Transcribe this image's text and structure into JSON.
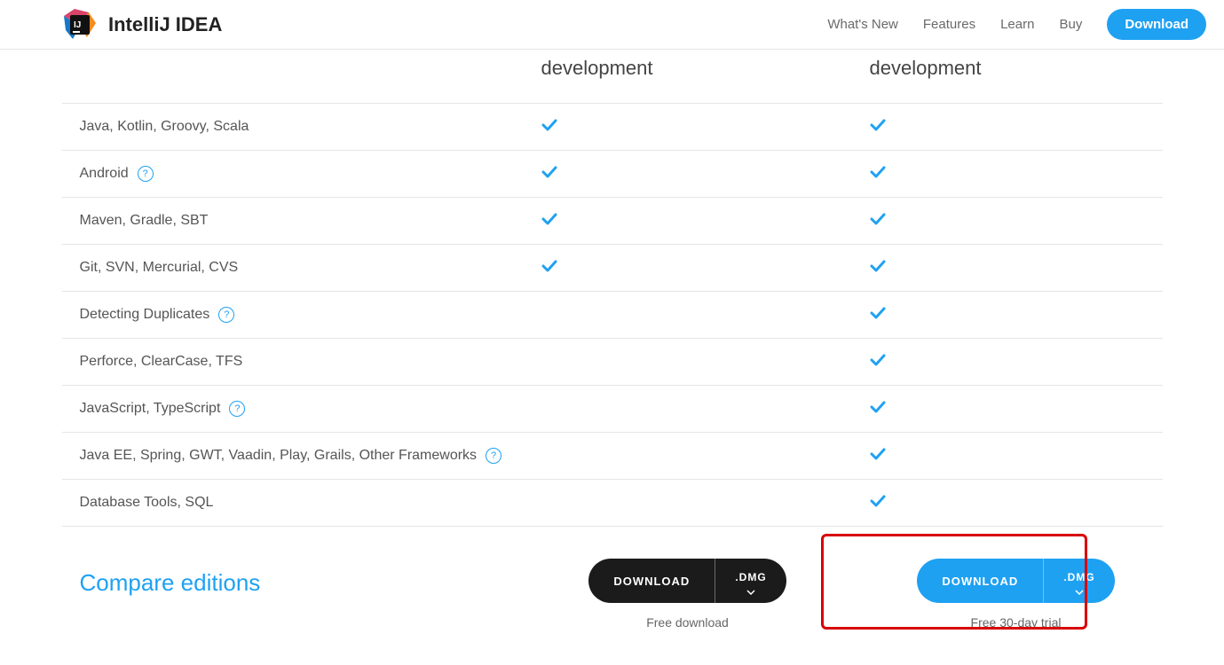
{
  "brand": {
    "title": "IntelliJ IDEA"
  },
  "nav": {
    "whats_new": "What's New",
    "features": "Features",
    "learn": "Learn",
    "buy": "Buy",
    "download": "Download"
  },
  "columns": {
    "community": "development",
    "ultimate": "development"
  },
  "features": [
    {
      "label": "Java, Kotlin, Groovy, Scala",
      "help": false,
      "community": true,
      "ultimate": true
    },
    {
      "label": "Android",
      "help": true,
      "community": true,
      "ultimate": true
    },
    {
      "label": "Maven, Gradle, SBT",
      "help": false,
      "community": true,
      "ultimate": true
    },
    {
      "label": "Git, SVN, Mercurial, CVS",
      "help": false,
      "community": true,
      "ultimate": true
    },
    {
      "label": "Detecting Duplicates",
      "help": true,
      "community": false,
      "ultimate": true
    },
    {
      "label": "Perforce, ClearCase, TFS",
      "help": false,
      "community": false,
      "ultimate": true
    },
    {
      "label": "JavaScript, TypeScript",
      "help": true,
      "community": false,
      "ultimate": true
    },
    {
      "label": "Java EE, Spring, GWT, Vaadin, Play, Grails, Other Frameworks",
      "help": true,
      "community": false,
      "ultimate": true
    },
    {
      "label": "Database Tools, SQL",
      "help": false,
      "community": false,
      "ultimate": true
    }
  ],
  "compare": "Compare editions",
  "download_buttons": {
    "label": "DOWNLOAD",
    "ext": ".DMG",
    "community_sub": "Free download",
    "ultimate_sub": "Free 30-day trial"
  },
  "help_glyph": "?"
}
